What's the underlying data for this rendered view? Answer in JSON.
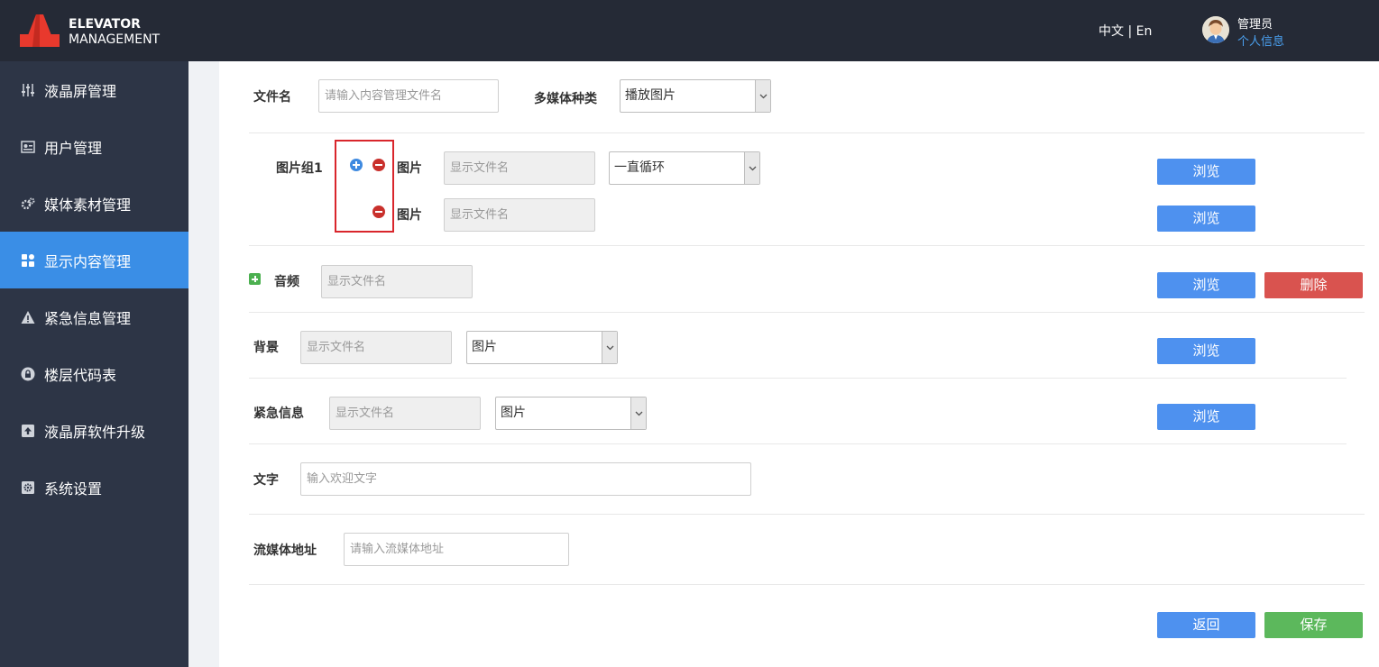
{
  "app": {
    "logo_line1": "ELEVATOR",
    "logo_line2": "MANAGEMENT",
    "lang": "中文 | En",
    "user_name": "管理员",
    "user_info": "个人信息"
  },
  "sidebar": {
    "items": [
      {
        "label": "液晶屏管理",
        "icon": "sliders-icon"
      },
      {
        "label": "用户管理",
        "icon": "user-card-icon"
      },
      {
        "label": "媒体素材管理",
        "icon": "gears-icon"
      },
      {
        "label": "显示内容管理",
        "icon": "grid-icon",
        "active": true
      },
      {
        "label": "紧急信息管理",
        "icon": "warning-icon"
      },
      {
        "label": "楼层代码表",
        "icon": "lock-icon"
      },
      {
        "label": "液晶屏软件升级",
        "icon": "upload-icon"
      },
      {
        "label": "系统设置",
        "icon": "gear-icon"
      }
    ]
  },
  "form": {
    "filename_label": "文件名",
    "filename_placeholder": "请输入内容管理文件名",
    "media_type_label": "多媒体种类",
    "media_type_value": "播放图片",
    "group_label": "图片组1",
    "image_label": "图片",
    "image_placeholder": "显示文件名",
    "loop_value": "一直循环",
    "browse_label": "浏览",
    "delete_label": "删除",
    "audio_label": "音频",
    "audio_placeholder": "显示文件名",
    "background_label": "背景",
    "background_placeholder": "显示文件名",
    "background_type": "图片",
    "emergency_label": "紧急信息",
    "emergency_placeholder": "显示文件名",
    "emergency_type": "图片",
    "text_label": "文字",
    "text_placeholder": "输入欢迎文字",
    "stream_label": "流媒体地址",
    "stream_placeholder": "请输入流媒体地址",
    "back_label": "返回",
    "save_label": "保存"
  },
  "colors": {
    "topbar": "#252a36",
    "sidebar": "#2d3546",
    "active": "#3a8ee6",
    "blue_button": "#4e91ef",
    "red_button": "#d9534f",
    "green_button": "#5cb85c"
  }
}
